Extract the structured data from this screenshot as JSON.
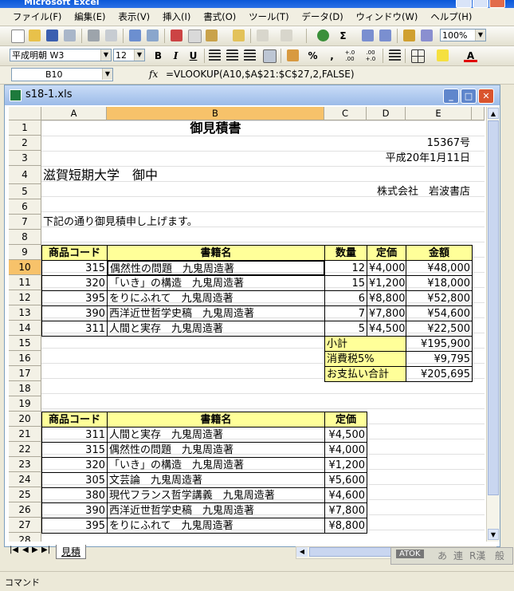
{
  "app": {
    "title": "Microsoft Excel"
  },
  "menu": [
    "ファイル(F)",
    "編集(E)",
    "表示(V)",
    "挿入(I)",
    "書式(O)",
    "ツール(T)",
    "データ(D)",
    "ウィンドウ(W)",
    "ヘルプ(H)"
  ],
  "toolbar": {
    "zoom": "100%"
  },
  "format_toolbar": {
    "font": "平成明朝 W3",
    "size": "12",
    "bold": "B",
    "italic": "I",
    "underline": "U",
    "percent": "%",
    "comma": ",",
    "inc_decimal": "+.0 .00",
    "dec_decimal": ".00 +.0"
  },
  "formula_bar": {
    "name_box": "B10",
    "fx": "fx",
    "formula": "=VLOOKUP(A10,$A$21:$C$27,2,FALSE)"
  },
  "workbook": {
    "title": "s18-1.xls"
  },
  "columns": [
    "A",
    "B",
    "C",
    "D",
    "E"
  ],
  "rows": [
    "1",
    "2",
    "3",
    "4",
    "5",
    "6",
    "7",
    "8",
    "9",
    "10",
    "11",
    "12",
    "13",
    "14",
    "15",
    "16",
    "17",
    "18",
    "19",
    "20",
    "21",
    "22",
    "23",
    "24",
    "25",
    "26",
    "27",
    "28"
  ],
  "sheet": {
    "title": "御見積書",
    "doc_no": "15367号",
    "date": "平成20年1月11日",
    "to": "滋賀短期大学　御中",
    "from": "株式会社　岩波書店",
    "intro": "下記の通り御見積申し上げます。",
    "quote_headers": [
      "商品コード",
      "書籍名",
      "数量",
      "定価",
      "金額"
    ],
    "quote_rows": [
      [
        "315",
        "偶然性の問題　九鬼周造著",
        "12",
        "¥4,000",
        "¥48,000"
      ],
      [
        "320",
        "「いき」の構造　九鬼周造著",
        "15",
        "¥1,200",
        "¥18,000"
      ],
      [
        "395",
        "をりにふれて　九鬼周造著",
        "6",
        "¥8,800",
        "¥52,800"
      ],
      [
        "390",
        "西洋近世哲学史稿　九鬼周造著",
        "7",
        "¥7,800",
        "¥54,600"
      ],
      [
        "311",
        "人間と実存　九鬼周造著",
        "5",
        "¥4,500",
        "¥22,500"
      ]
    ],
    "totals": [
      [
        "小計",
        "¥195,900"
      ],
      [
        "消費税5%",
        "¥9,795"
      ],
      [
        "お支払い合計",
        "¥205,695"
      ]
    ],
    "master_headers": [
      "商品コード",
      "書籍名",
      "定価"
    ],
    "master_rows": [
      [
        "311",
        "人間と実存　九鬼周造著",
        "¥4,500"
      ],
      [
        "315",
        "偶然性の問題　九鬼周造著",
        "¥4,000"
      ],
      [
        "320",
        "「いき」の構造　九鬼周造著",
        "¥1,200"
      ],
      [
        "305",
        "文芸論　九鬼周造著",
        "¥5,600"
      ],
      [
        "380",
        "現代フランス哲学講義　九鬼周造著",
        "¥4,600"
      ],
      [
        "390",
        "西洋近世哲学史稿　九鬼周造著",
        "¥7,800"
      ],
      [
        "395",
        "をりにふれて　九鬼周造著",
        "¥8,800"
      ]
    ]
  },
  "sheet_tab": "見積",
  "ime": {
    "label": "ATOK",
    "items": [
      "あ",
      "連",
      "R漢",
      "般"
    ]
  },
  "status": "コマンド",
  "colors": {
    "header_fill": "#ffff99",
    "selected_header": "#f7c26a",
    "title_bar": "#0a58d8"
  }
}
